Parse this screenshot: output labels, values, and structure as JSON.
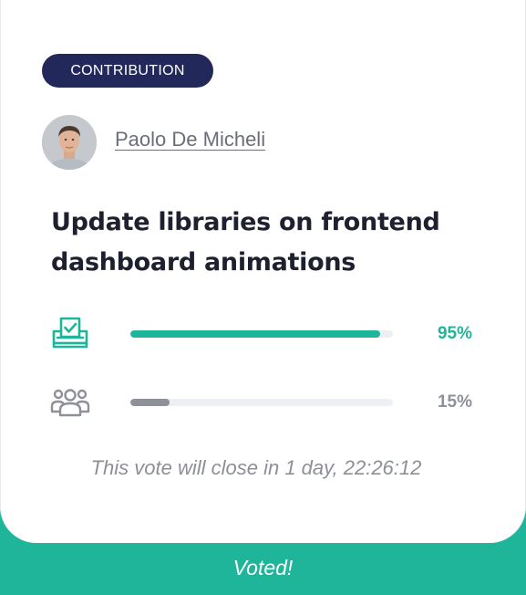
{
  "badge": {
    "label": "CONTRIBUTION"
  },
  "author": {
    "name": "Paolo De Micheli"
  },
  "title": "Update libraries on frontend dashboard animations",
  "votes": [
    {
      "icon": "ballot-box-icon",
      "percent_label": "95%",
      "value": 0.95,
      "color": "#1fb59b"
    },
    {
      "icon": "people-group-icon",
      "percent_label": "15%",
      "value": 0.15,
      "color": "#8f9199"
    }
  ],
  "notice": "This vote will close in 1 day, 22:26:12",
  "status": {
    "label": "Voted!"
  },
  "colors": {
    "accent": "#1fb59b",
    "badge_bg": "#22295a",
    "muted": "#8f9199",
    "title": "#1e2030"
  }
}
